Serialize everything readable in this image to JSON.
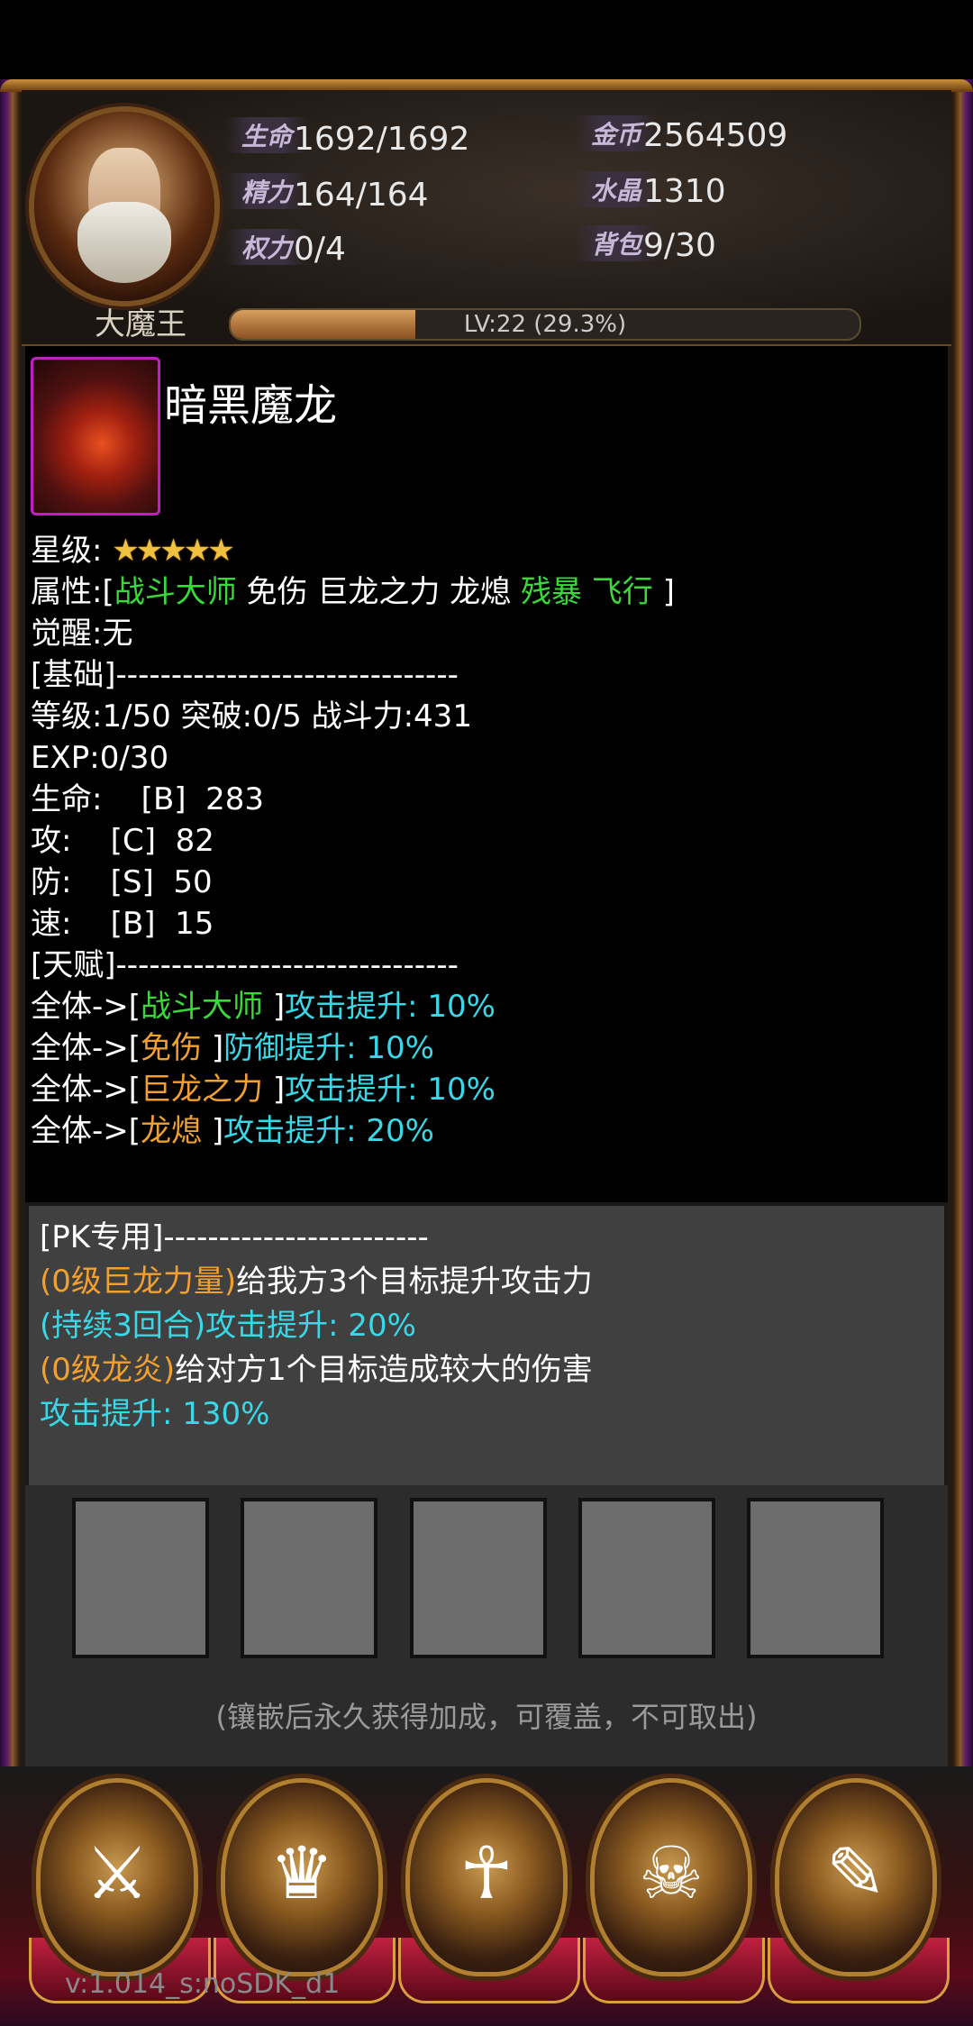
{
  "header": {
    "player_name": "大魔王",
    "stats": {
      "hp_label": "生命",
      "hp_value": "1692/1692",
      "energy_label": "精力",
      "energy_value": "164/164",
      "power_label": "权力",
      "power_value": "0/4",
      "gold_label": "金币",
      "gold_value": "2564509",
      "crystal_label": "水晶",
      "crystal_value": "1310",
      "bag_label": "背包",
      "bag_value": "9/30"
    },
    "level_text": "LV:22 (29.3%)",
    "level_progress_pct": 29.3
  },
  "item": {
    "name": "暗黑魔龙",
    "star_label": "星级:",
    "stars": "★★★★★",
    "attr_prefix": "属性:[",
    "attr_green1": "战斗大师",
    "attr_white": " 免伤 巨龙之力 龙熄 ",
    "attr_green2": "残暴 飞行",
    "attr_suffix": " ]",
    "awaken": "觉醒:无",
    "basic_header": "[基础]-------------------------------",
    "level_line": "等级:1/50  突破:0/5 战斗力:431",
    "exp_line": "EXP:0/30",
    "hp_line": "生命:    [B]  283",
    "atk_line": "攻:    [C]  82",
    "def_line": "防:    [S]  50",
    "spd_line": "速:    [B]  15",
    "talent_header": "[天赋]-------------------------------",
    "talents": [
      {
        "prefix": "全体->[",
        "name": "战斗大师",
        "name_color": "green",
        "close": " ]",
        "effect": "攻击提升: 10%"
      },
      {
        "prefix": "全体->[",
        "name": "免伤",
        "name_color": "orange",
        "close": " ]",
        "effect": "防御提升: 10%"
      },
      {
        "prefix": "全体->[",
        "name": "巨龙之力",
        "name_color": "orange",
        "close": " ]",
        "effect": "攻击提升: 10%"
      },
      {
        "prefix": "全体->[",
        "name": "龙熄",
        "name_color": "orange",
        "close": " ]",
        "effect": "攻击提升: 20%"
      }
    ]
  },
  "pk": {
    "header": "[PK专用]------------------------",
    "skill1_name": "(0级巨龙力量)",
    "skill1_desc": "给我方3个目标提升攻击力",
    "skill1_effect": "(持续3回合)攻击提升: 20%",
    "skill2_name": "(0级龙炎)",
    "skill2_desc": "给对方1个目标造成较大的伤害",
    "skill2_effect": "攻击提升: 130%"
  },
  "slots_hint": "(镶嵌后永久获得加成，可覆盖，不可取出)",
  "nav": {
    "icons": [
      "armor-sword-icon",
      "golden-helmet-icon",
      "hero-portrait-icon",
      "treasure-chest-icon",
      "spell-book-icon"
    ]
  },
  "version": "v:1.014_s:noSDK_d1",
  "colors": {
    "green": "#39d93a",
    "orange": "#f0a030",
    "cyan": "#38d8e8",
    "rarity_border": "#c020c0"
  }
}
